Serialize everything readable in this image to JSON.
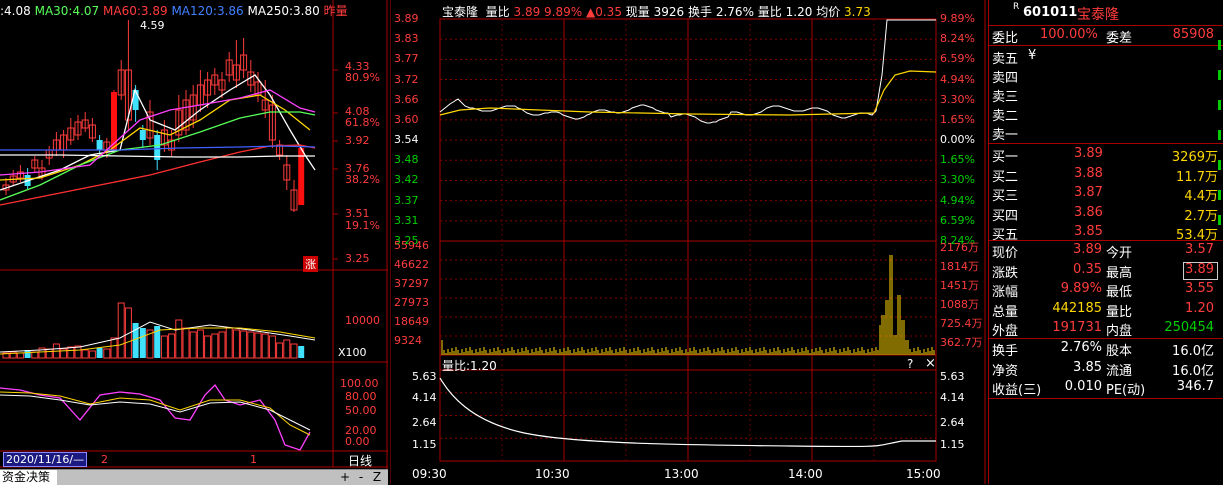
{
  "kline": {
    "ma_bar": [
      {
        "label": ":",
        "value": "4.08",
        "color": "#ffffff"
      },
      {
        "label": "MA30:",
        "value": "4.07",
        "color": "#58ff58"
      },
      {
        "label": "MA60:",
        "value": "3.89",
        "color": "#ff3c3c"
      },
      {
        "label": "MA120:",
        "value": "3.86",
        "color": "#4080ff"
      },
      {
        "label": "MA250:",
        "value": "3.80",
        "color": "#ffffff"
      }
    ],
    "ma_tag": "昨量",
    "high_label": "4.59",
    "zhang": "涨",
    "price_ticks": [
      "4.33",
      "4.08",
      "3.92",
      "3.76",
      "3.51",
      "3.25"
    ],
    "pct_ticks": [
      "80.9%",
      "61.8%",
      "38.2%",
      "19.1%"
    ],
    "vol_tick": "10000",
    "vol_unit": "X100",
    "osc_ticks": [
      "100.00",
      "80.00",
      "50.00",
      "20.00",
      "0.00"
    ],
    "date_box": "2020/11/16/—",
    "marker_2": "2",
    "marker_1": "1",
    "period": "日线",
    "bottom_tab": "资金决策",
    "btn_plus": "+",
    "btn_minus": "-",
    "btn_z": "Z"
  },
  "intraday": {
    "name": "宝泰隆",
    "ratio_label": "量比",
    "ratio_val": "3.89",
    "pct": "9.89%",
    "change": "▲0.35",
    "now_vol_label": "现量",
    "now_vol": "3926",
    "turnover_label": "换手",
    "turnover": "2.76%",
    "ratio2_label": "量比",
    "ratio2": "1.20",
    "avg_label": "均价",
    "avg": "3.73",
    "left_up": [
      "3.89",
      "3.83",
      "3.77",
      "3.72",
      "3.66",
      "3.60"
    ],
    "mid": "3.54",
    "left_down": [
      "3.48",
      "3.42",
      "3.37",
      "3.31",
      "3.25"
    ],
    "right_up": [
      "9.89%",
      "8.24%",
      "6.59%",
      "4.94%",
      "3.30%",
      "1.65%"
    ],
    "right_mid": "0.00%",
    "right_down": [
      "1.65%",
      "3.30%",
      "4.94%",
      "6.59%",
      "8.24%"
    ],
    "vol_left": [
      "55946",
      "46622",
      "37297",
      "27973",
      "18649",
      "9324"
    ],
    "vol_right": [
      "2176万",
      "1814万",
      "1451万",
      "1088万",
      "725.4万",
      "362.7万"
    ],
    "ratio_title": "量比:1.20",
    "ratio_q": "?",
    "ratio_x": "×",
    "ratio_ticks": [
      "5.63",
      "4.14",
      "2.64",
      "1.15"
    ],
    "times": [
      "09:30",
      "10:30",
      "13:00",
      "14:00",
      "15:00"
    ]
  },
  "quote": {
    "r_mark": "R",
    "code": "601011",
    "name": "宝泰隆",
    "weibi_label": "委比",
    "weibi": "100.00%",
    "weicha_label": "委差",
    "weicha": "85908",
    "asks": [
      {
        "label": "卖五",
        "price": "¥",
        "vol": ""
      },
      {
        "label": "卖四",
        "price": "",
        "vol": ""
      },
      {
        "label": "卖三",
        "price": "",
        "vol": ""
      },
      {
        "label": "卖二",
        "price": "",
        "vol": ""
      },
      {
        "label": "卖一",
        "price": "",
        "vol": ""
      }
    ],
    "bids": [
      {
        "label": "买一",
        "price": "3.89",
        "vol": "3269万"
      },
      {
        "label": "买二",
        "price": "3.88",
        "vol": "11.7万"
      },
      {
        "label": "买三",
        "price": "3.87",
        "vol": "4.4万"
      },
      {
        "label": "买四",
        "price": "3.86",
        "vol": "2.7万"
      },
      {
        "label": "买五",
        "price": "3.85",
        "vol": "53.4万"
      }
    ],
    "stats": [
      {
        "l1": "现价",
        "v1": "3.89",
        "c1": "#ff3c3c",
        "l2": "今开",
        "v2": "3.57",
        "c2": "#ff3c3c"
      },
      {
        "l1": "涨跌",
        "v1": "0.35",
        "c1": "#ff3c3c",
        "l2": "最高",
        "v2": "3.89",
        "c2": "#ff3c3c"
      },
      {
        "l1": "涨幅",
        "v1": "9.89%",
        "c1": "#ff3c3c",
        "l2": "最低",
        "v2": "3.55",
        "c2": "#ff3c3c"
      },
      {
        "l1": "总量",
        "v1": "442185",
        "c1": "#ffd700",
        "l2": "量比",
        "v2": "1.20",
        "c2": "#ff3c3c"
      },
      {
        "l1": "外盘",
        "v1": "191731",
        "c1": "#ff3c3c",
        "l2": "内盘",
        "v2": "250454",
        "c2": "#00d000"
      }
    ],
    "fin": [
      {
        "l1": "换手",
        "v1": "2.76%",
        "l2": "股本",
        "v2": "16.0亿"
      },
      {
        "l1": "净资",
        "v1": "3.85",
        "l2": "流通",
        "v2": "16.0亿"
      },
      {
        "l1": "收益(三)",
        "v1": "0.010",
        "l2": "PE(动)",
        "v2": "346.7"
      }
    ]
  }
}
